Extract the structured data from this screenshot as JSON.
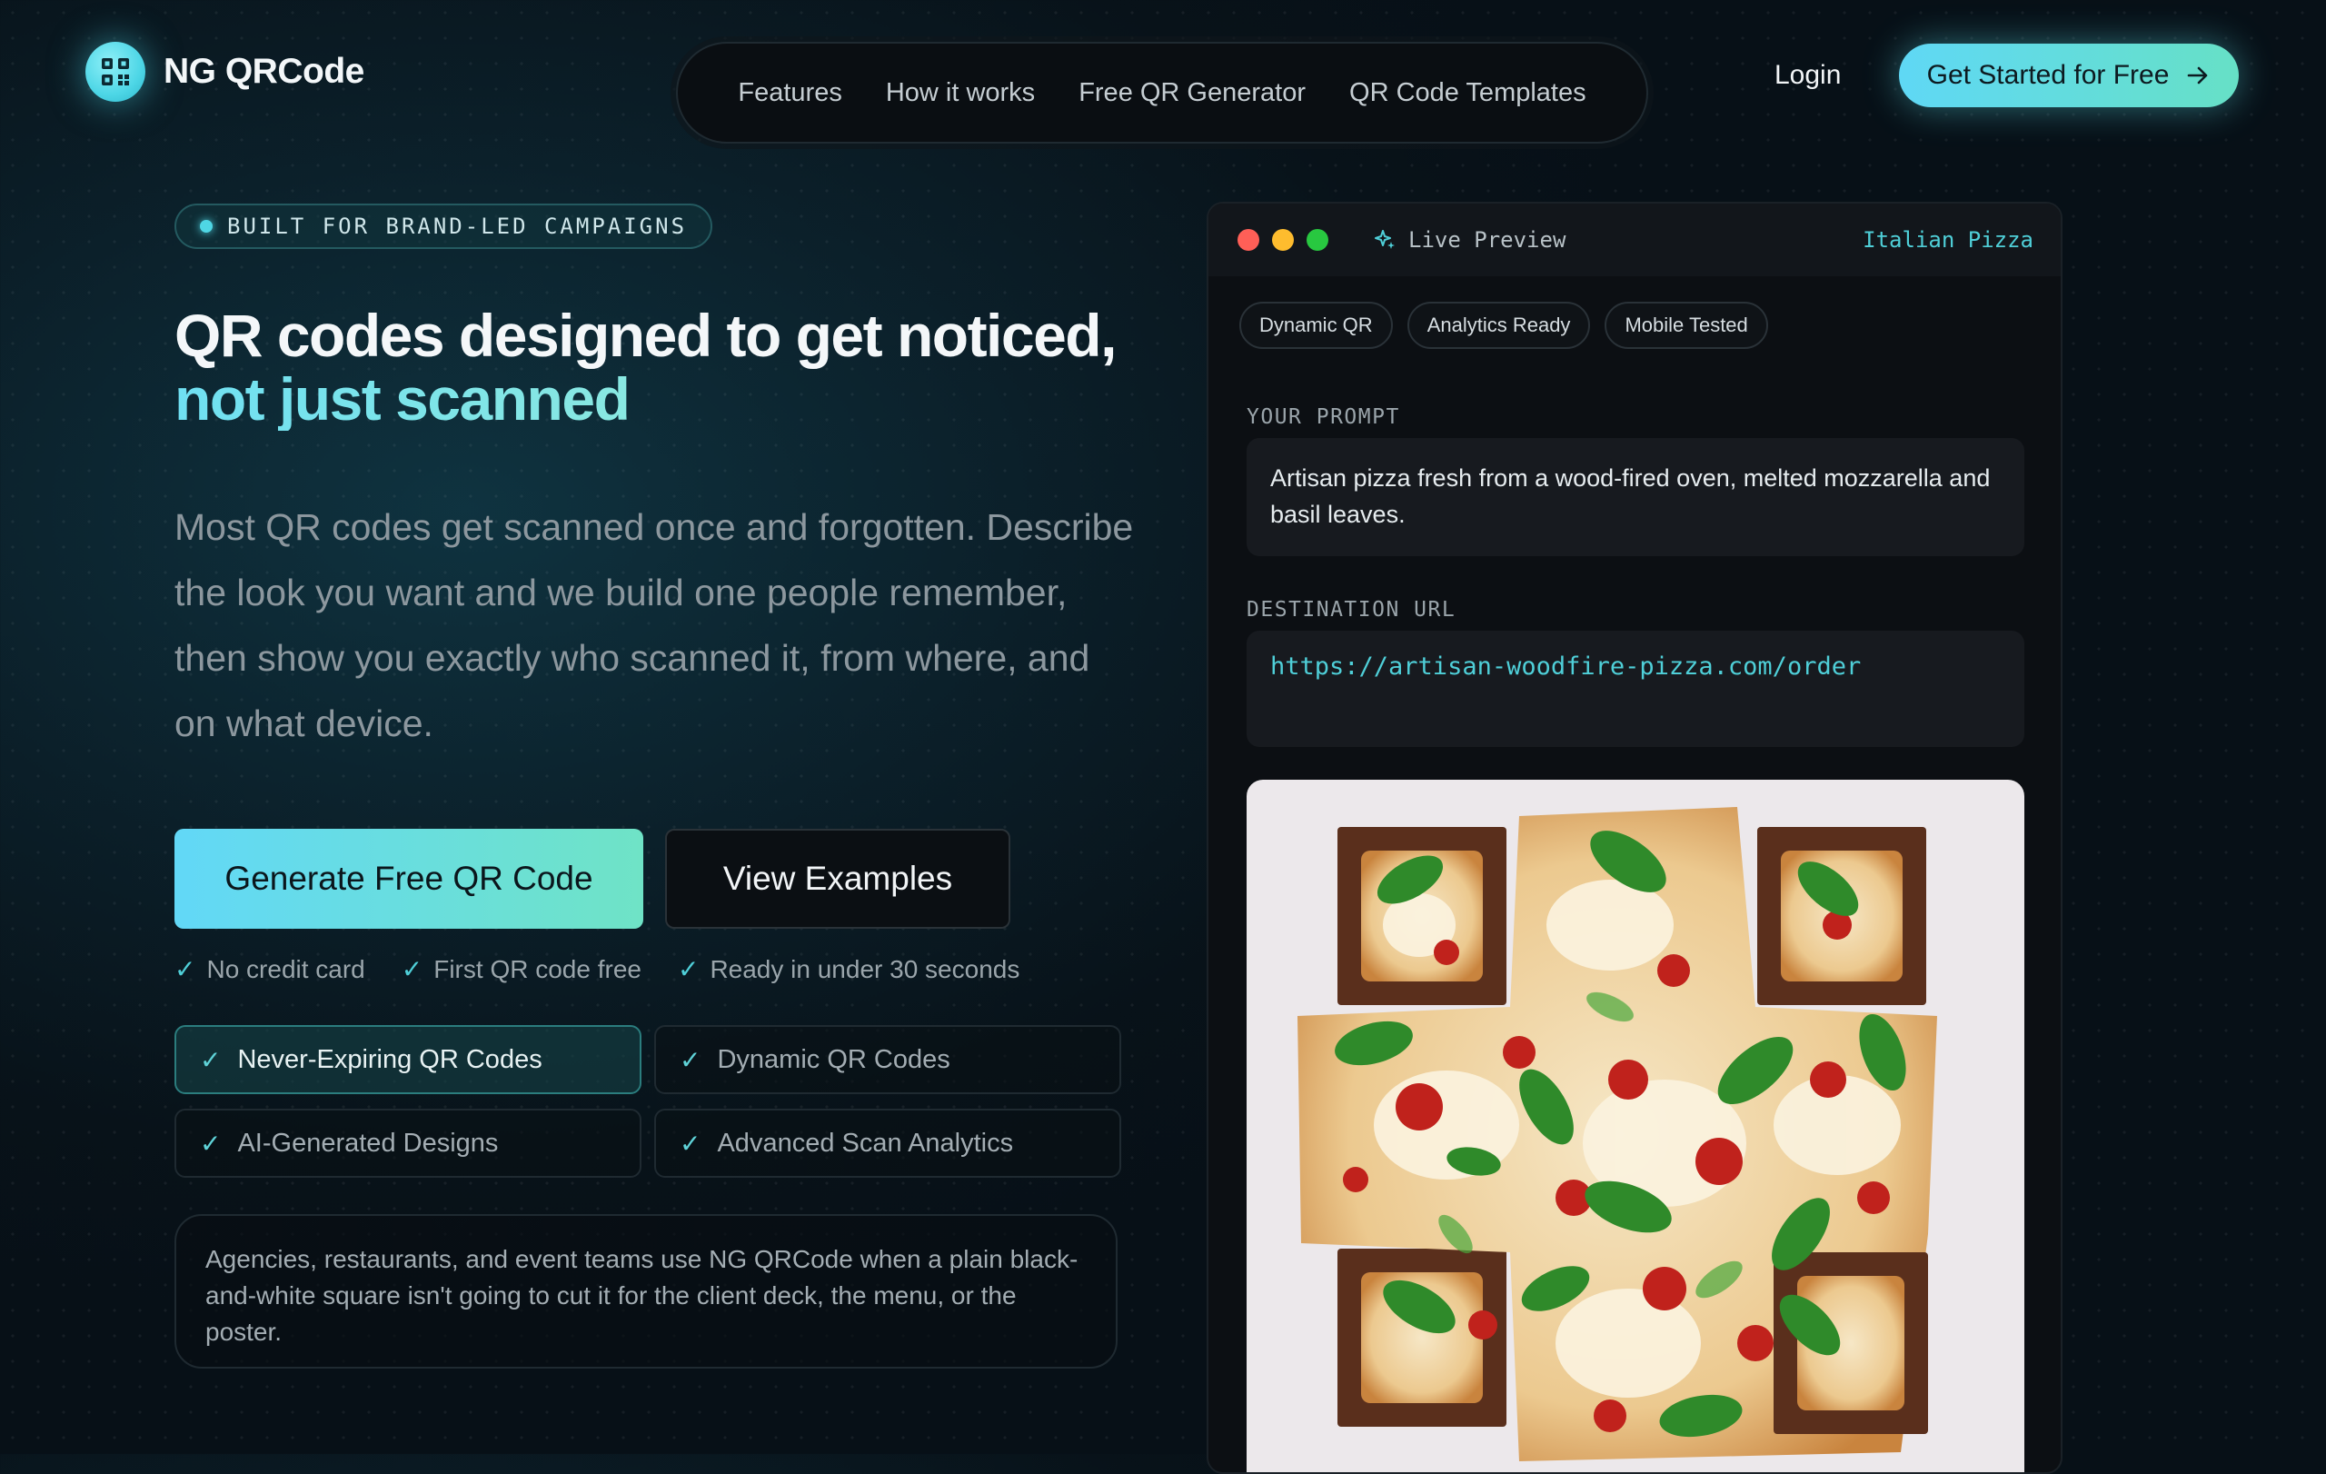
{
  "brand": {
    "name": "NG QRCode",
    "logo_icon": "qr-code-icon"
  },
  "nav": {
    "items": [
      {
        "label": "Features"
      },
      {
        "label": "How it works"
      },
      {
        "label": "Free QR Generator"
      },
      {
        "label": "QR Code Templates"
      }
    ],
    "login_label": "Login",
    "cta_label": "Get Started for Free",
    "cta_icon": "arrow-right-icon"
  },
  "hero": {
    "badge": "BUILT FOR BRAND-LED CAMPAIGNS",
    "title_line1": "QR codes designed to get noticed,",
    "title_line2": "not just scanned",
    "lead": "Most QR codes get scanned once and forgotten. Describe the look you want and we build one people remember, then show you exactly who scanned it, from where, and on what device.",
    "primary_cta": "Generate Free QR Code",
    "secondary_cta": "View Examples",
    "checks": [
      "No credit card",
      "First QR code free",
      "Ready in under 30 seconds"
    ],
    "features": [
      {
        "label": "Never-Expiring QR Codes",
        "active": true
      },
      {
        "label": "Dynamic QR Codes",
        "active": false
      },
      {
        "label": "AI-Generated Designs",
        "active": false
      },
      {
        "label": "Advanced Scan Analytics",
        "active": false
      }
    ],
    "testimonial": "Agencies, restaurants, and event teams use NG QRCode when a plain black-and-white square isn't going to cut it for the client deck, the menu, or the poster."
  },
  "preview": {
    "title": "Live Preview",
    "title_icon": "sparkle-icon",
    "template_name": "Italian Pizza",
    "tags": [
      "Dynamic QR",
      "Analytics Ready",
      "Mobile Tested"
    ],
    "prompt_label": "YOUR PROMPT",
    "prompt_text": "Artisan pizza fresh from a wood-fired oven, melted mozzarella and basil leaves.",
    "url_label": "DESTINATION URL",
    "url_text": "https://artisan-woodfire-pizza.com/order",
    "image_alt": "pizza-qr-code-image"
  },
  "colors": {
    "accent": "#4fcfd8",
    "gradient_start": "#62d8f7",
    "gradient_end": "#6fe3c6",
    "traffic_red": "#ff5f57",
    "traffic_yellow": "#febc2e",
    "traffic_green": "#28c840"
  }
}
